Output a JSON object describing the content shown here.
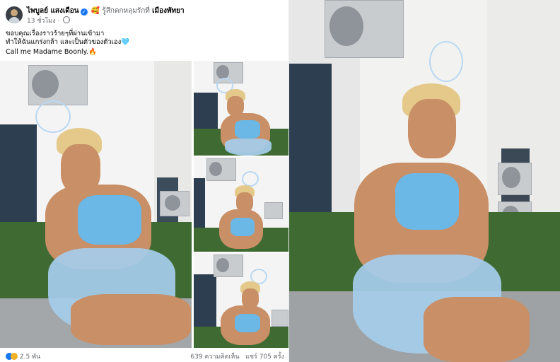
{
  "post": {
    "author_name": "ไพบูลย์ แสงเดือน",
    "verified_badge": "✓",
    "feeling_emoji": "🥰",
    "feeling_text": "รู้สึกตกหลุมรักที่",
    "location": "เมืองพัทยา",
    "time_ago": "13 ชั่วโมง",
    "time_separator": "·",
    "caption_line1": "ขอบคุณเรื่องราวร้ายๆที่ผ่านเข้ามา",
    "caption_line2": "ทำให้ฉันแกร่งกล้า และเป็นตัวของตัวเอง",
    "caption_line2_emoji": "🩵",
    "caption_line3": "Call me Madame Boonly.",
    "caption_line3_emoji": "🔥",
    "reaction_count": "2.5 พัน",
    "comments": "639 ความคิดเห็น",
    "shares": "แชร์ 705 ครั้ง",
    "reaction_icons": [
      "like-icon",
      "haha-icon"
    ]
  },
  "colors": {
    "facebook_blue": "#1877f2",
    "secondary_text": "#65676b",
    "primary_text": "#050505"
  }
}
